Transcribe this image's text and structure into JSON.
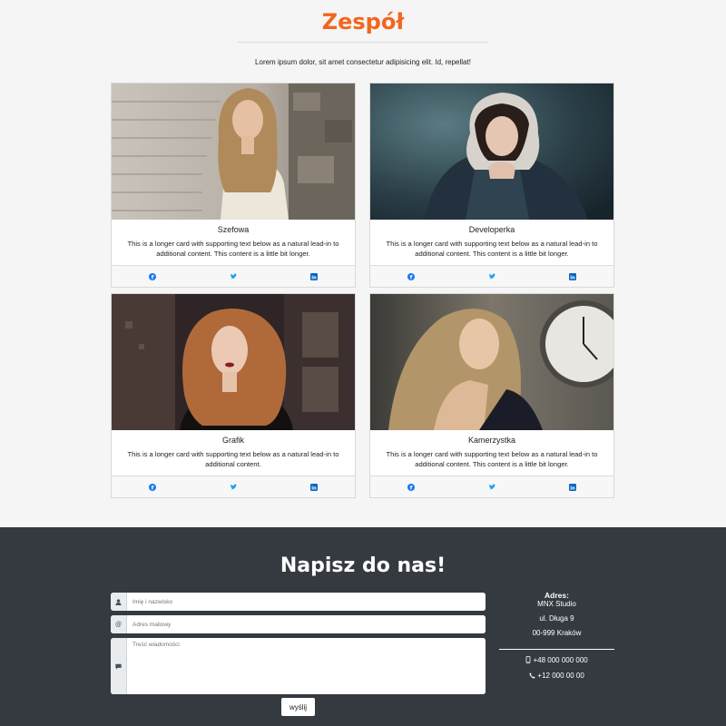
{
  "team": {
    "title": "Zespół",
    "lead": "Lorem ipsum dolor, sit amet consectetur adipisicing elit. Id, repellat!",
    "cards": [
      {
        "name": "Szefowa",
        "text": "This is a longer card with supporting text below as a natural lead-in to additional content. This content is a little bit longer."
      },
      {
        "name": "Developerka",
        "text": "This is a longer card with supporting text below as a natural lead-in to additional content. This content is a little bit longer."
      },
      {
        "name": "Grafik",
        "text": "This is a longer card with supporting text below as a natural lead-in to additional content."
      },
      {
        "name": "Kamerzystka",
        "text": "This is a longer card with supporting text below as a natural lead-in to additional content. This content is a little bit longer."
      }
    ],
    "social_icons": [
      "facebook-icon",
      "twitter-icon",
      "linkedin-icon"
    ],
    "accent": "#f2661d",
    "link_color": "#1877f2"
  },
  "contact": {
    "title": "Napisz do nas!",
    "name_placeholder": "Imię i nazwisko",
    "email_placeholder": "Adres mailowy",
    "message_placeholder": "Treść wiadomości",
    "send_label": "wyślij",
    "address_heading": "Adres:",
    "company": "MNX Studio",
    "street": "ul. Długa 9",
    "city": "00-999 Kraków",
    "mobile": "+48 000 000 000",
    "phone": "+12 000 00 00",
    "background": "#343a40"
  }
}
